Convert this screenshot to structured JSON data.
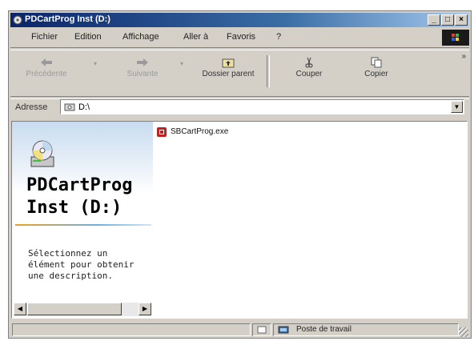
{
  "window": {
    "title": "PDCartProg Inst (D:)",
    "min_glyph": "_",
    "max_glyph": "□",
    "close_glyph": "×"
  },
  "menu": [
    "Fichier",
    "Edition",
    "Affichage",
    "Aller à",
    "Favoris",
    "?"
  ],
  "toolbar": {
    "back": "Précédente",
    "forward": "Suivante",
    "up": "Dossier parent",
    "cut": "Couper",
    "copy": "Copier",
    "more": "»"
  },
  "address": {
    "label": "Adresse",
    "value": "D:\\"
  },
  "left_pane": {
    "title_line1": "PDCartProg",
    "title_line2": "Inst (D:)",
    "description": "Sélectionnez un élément pour obtenir une description."
  },
  "files": [
    {
      "name": "SBCartProg.exe",
      "icon": "exe-icon"
    }
  ],
  "status": {
    "zone": "Poste de travail"
  },
  "colors": {
    "title_start": "#0a246a",
    "title_end": "#a6caf0",
    "chrome": "#d4d0c8"
  }
}
